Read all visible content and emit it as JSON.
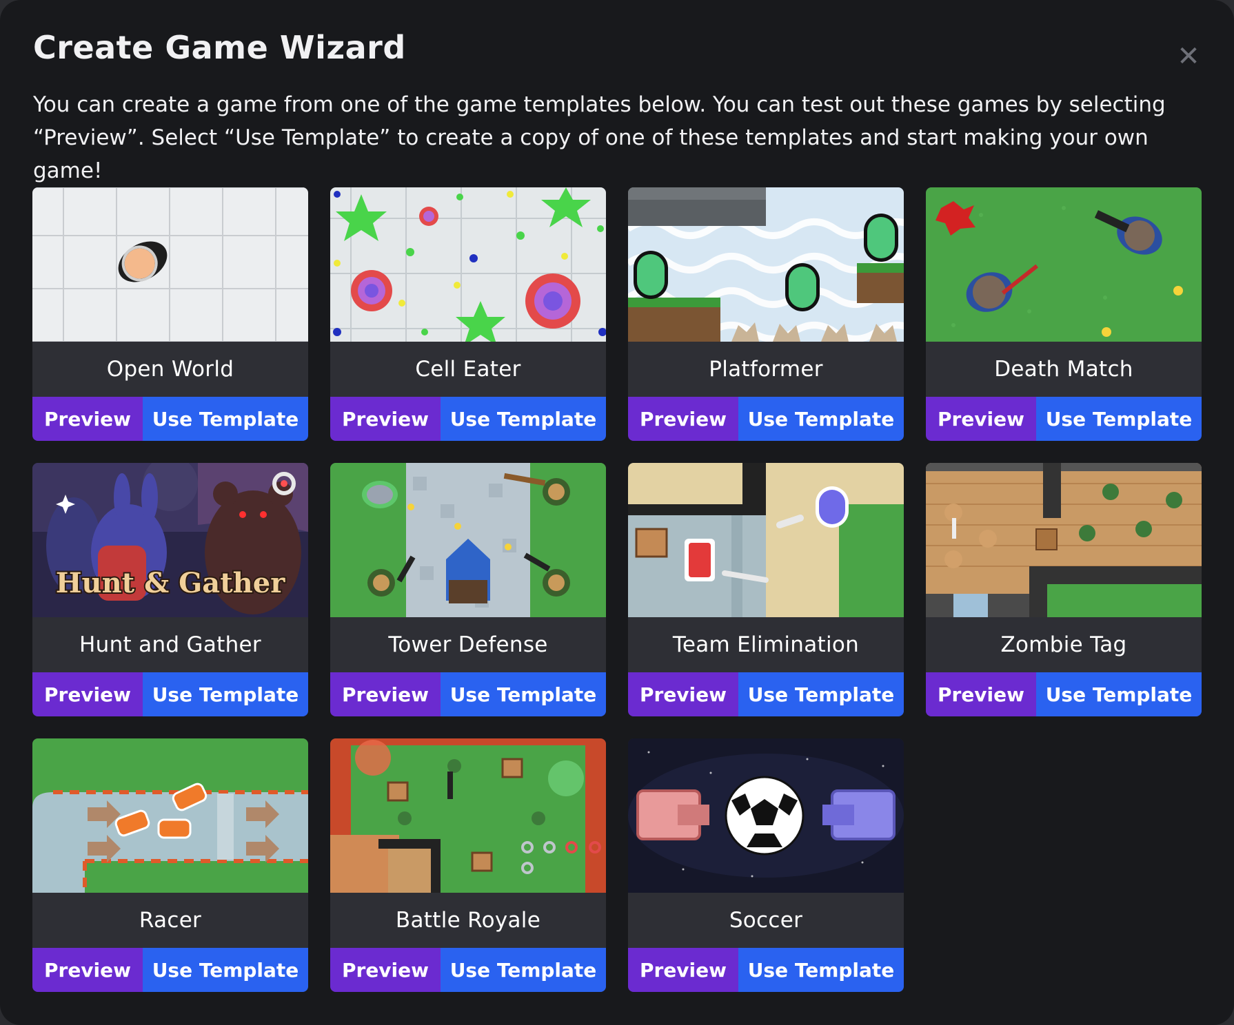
{
  "dialog": {
    "title": "Create Game Wizard",
    "close_icon": "close-icon",
    "description": "You can create a game from one of the game templates below. You can test out these games by selecting “Preview”. Select “Use Template” to create a copy of one of these templates and start making your own game!"
  },
  "templates": [
    {
      "name": "Open World",
      "preview_label": "Preview",
      "use_label": "Use Template"
    },
    {
      "name": "Cell Eater",
      "preview_label": "Preview",
      "use_label": "Use Template"
    },
    {
      "name": "Platformer",
      "preview_label": "Preview",
      "use_label": "Use Template"
    },
    {
      "name": "Death Match",
      "preview_label": "Preview",
      "use_label": "Use Template"
    },
    {
      "name": "Hunt and Gather",
      "preview_label": "Preview",
      "use_label": "Use Template",
      "thumbnail_text": "Hunt & Gather"
    },
    {
      "name": "Tower Defense",
      "preview_label": "Preview",
      "use_label": "Use Template"
    },
    {
      "name": "Team Elimination",
      "preview_label": "Preview",
      "use_label": "Use Template"
    },
    {
      "name": "Zombie Tag",
      "preview_label": "Preview",
      "use_label": "Use Template"
    },
    {
      "name": "Racer",
      "preview_label": "Preview",
      "use_label": "Use Template"
    },
    {
      "name": "Battle Royale",
      "preview_label": "Preview",
      "use_label": "Use Template"
    },
    {
      "name": "Soccer",
      "preview_label": "Preview",
      "use_label": "Use Template"
    }
  ],
  "colors": {
    "background": "#18191c",
    "card": "#2e2f35",
    "preview_button": "#6b2bd0",
    "use_template_button": "#2a62f0"
  }
}
